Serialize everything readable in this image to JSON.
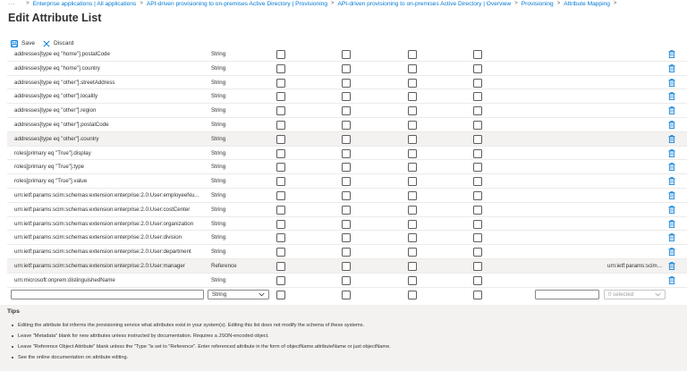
{
  "breadcrumb": {
    "items": [
      "Enterprise applications | All applications",
      "API-driven provisioning to on-premises Active Directory | Provisioning",
      "API-driven provisioning to on-premises Active Directory | Overview",
      "Provisioning",
      "Attribute Mapping"
    ]
  },
  "page": {
    "title": "Edit Attribute List"
  },
  "toolbar": {
    "save_label": "Save",
    "discard_label": "Discard"
  },
  "colors": {
    "accent": "#0078d4",
    "checkbox_border": "#605e5c",
    "tips_background": "#f3f2f1"
  },
  "table": {
    "rows": [
      {
        "name": "addresses[type eq \"home\"].postalCode",
        "type": "String",
        "reference": ""
      },
      {
        "name": "addresses[type eq \"home\"].country",
        "type": "String",
        "reference": ""
      },
      {
        "name": "addresses[type eq \"other\"].streetAddress",
        "type": "String",
        "reference": ""
      },
      {
        "name": "addresses[type eq \"other\"].locality",
        "type": "String",
        "reference": ""
      },
      {
        "name": "addresses[type eq \"other\"].region",
        "type": "String",
        "reference": ""
      },
      {
        "name": "addresses[type eq \"other\"].postalCode",
        "type": "String",
        "reference": ""
      },
      {
        "name": "addresses[type eq \"other\"].country",
        "type": "String",
        "reference": ""
      },
      {
        "name": "roles[primary eq \"True\"].display",
        "type": "String",
        "reference": ""
      },
      {
        "name": "roles[primary eq \"True\"].type",
        "type": "String",
        "reference": ""
      },
      {
        "name": "roles[primary eq \"True\"].value",
        "type": "String",
        "reference": ""
      },
      {
        "name": "urn:ietf:params:scim:schemas:extension:enterprise:2.0:User:employeeNu...",
        "type": "String",
        "reference": ""
      },
      {
        "name": "urn:ietf:params:scim:schemas:extension:enterprise:2.0:User:costCenter",
        "type": "String",
        "reference": ""
      },
      {
        "name": "urn:ietf:params:scim:schemas:extension:enterprise:2.0:User:organization",
        "type": "String",
        "reference": ""
      },
      {
        "name": "urn:ietf:params:scim:schemas:extension:enterprise:2.0:User:division",
        "type": "String",
        "reference": ""
      },
      {
        "name": "urn:ietf:params:scim:schemas:extension:enterprise:2.0:User:department",
        "type": "String",
        "reference": ""
      },
      {
        "name": "urn:ietf:params:scim:schemas:extension:enterprise:2.0:User:manager",
        "type": "Reference",
        "reference": "urn:ietf:params:scim..."
      },
      {
        "name": "urn:microsoft:onprem:distinguishedName",
        "type": "String",
        "reference": ""
      }
    ],
    "new_row": {
      "name_value": "",
      "type_value": "String",
      "reference_value": "",
      "multi_placeholder": "0 selected"
    }
  },
  "tips": {
    "title": "Tips",
    "items": [
      "Editing the attribute list informs the provisioning service what attributes exist in your system(s). Editing this list does not modify the schema of these systems.",
      "Leave \"Metadata\" blank for new attributes unless instructed by documentation. Requires a JSON-encoded object.",
      "Leave \"Reference Object Attribute\" blank unless the \"Type \"is set to \"Reference\". Enter referenced attribute in the form of objectName.attributeName or just objectName.",
      "See the online documentation on attribute editing."
    ]
  }
}
